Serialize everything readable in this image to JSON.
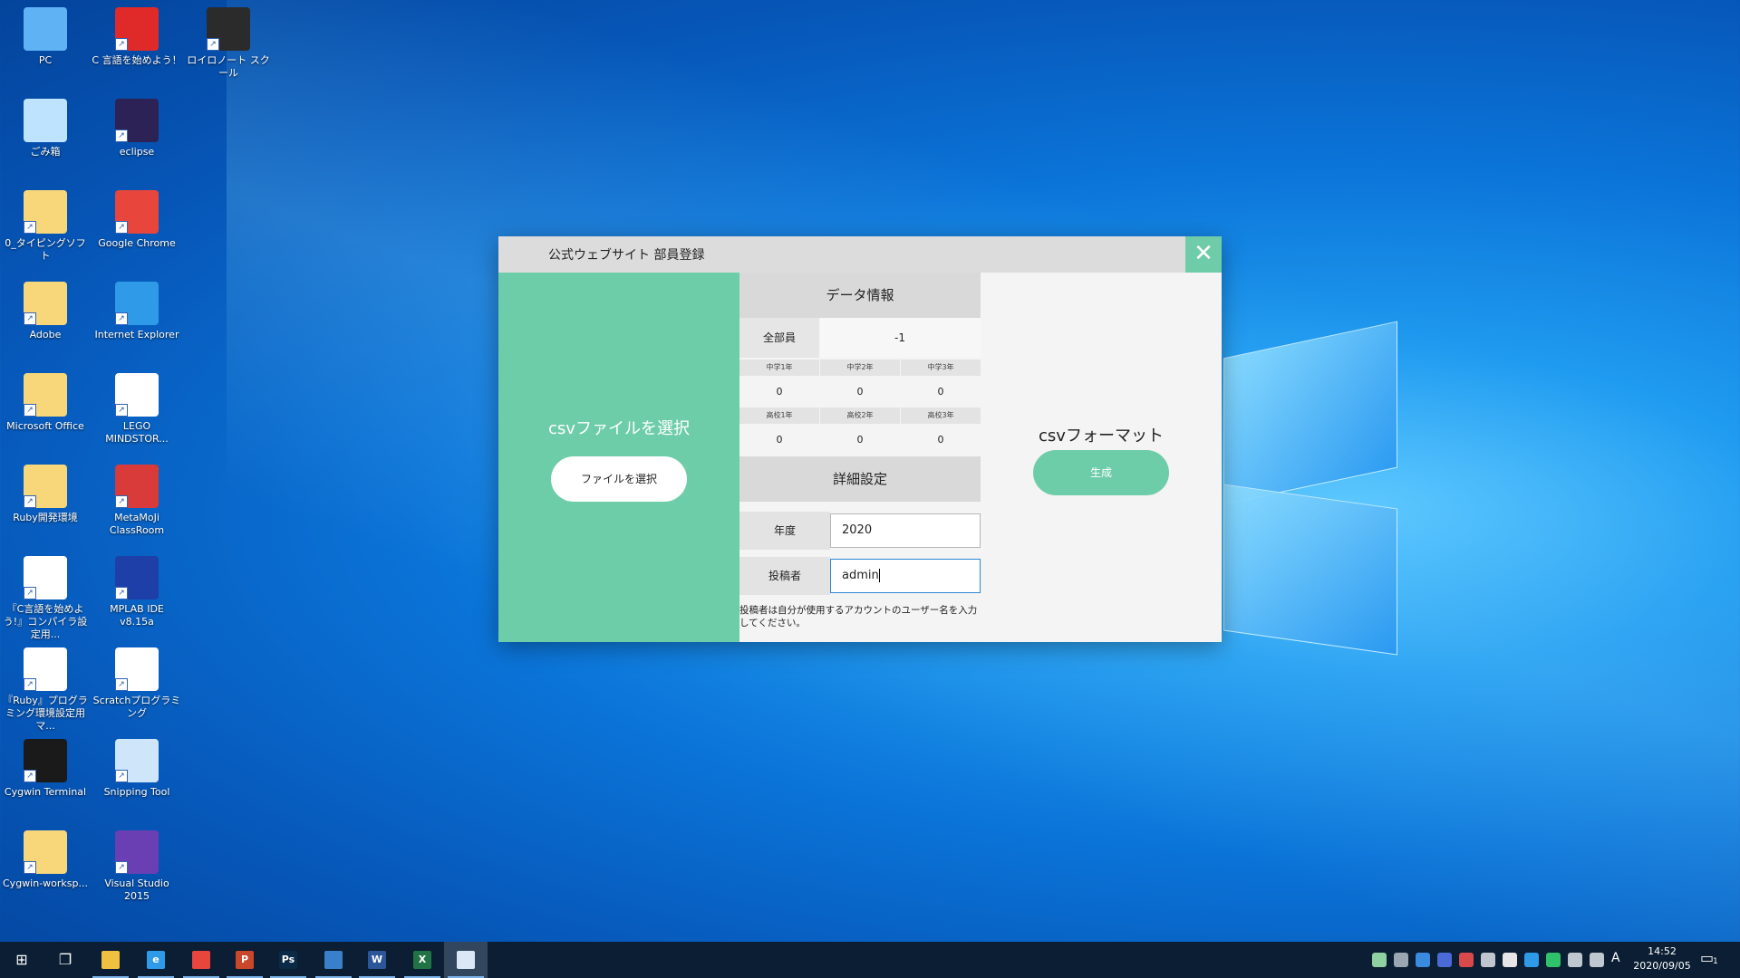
{
  "desktop": {
    "icons": [
      {
        "label": "PC",
        "icon": "pc-icon",
        "color": "#5fb3f5"
      },
      {
        "label": "C 言語を始めよう！",
        "icon": "c-language-icon",
        "color": "#e02a2a"
      },
      {
        "label": "ロイロノート スクール",
        "icon": "loilonote-icon",
        "color": "#2b2b2b"
      },
      {
        "label": "ごみ箱",
        "icon": "recycle-bin-icon",
        "color": "#bde3ff"
      },
      {
        "label": "eclipse",
        "icon": "eclipse-icon",
        "color": "#2c2255"
      },
      {
        "label": "0_タイピングソフト",
        "icon": "folder-icon",
        "color": "#f7d77a"
      },
      {
        "label": "Google Chrome",
        "icon": "chrome-icon",
        "color": "#e8453c"
      },
      {
        "label": "Adobe",
        "icon": "folder-icon",
        "color": "#f7d77a"
      },
      {
        "label": "Internet Explorer",
        "icon": "internet-explorer-icon",
        "color": "#2f9ae8"
      },
      {
        "label": "Microsoft Office",
        "icon": "folder-icon",
        "color": "#f7d77a"
      },
      {
        "label": "LEGO MINDSTOR...",
        "icon": "lego-mindstorms-icon",
        "color": "#ffffff"
      },
      {
        "label": "Ruby開発環境",
        "icon": "folder-icon",
        "color": "#f7d77a"
      },
      {
        "label": "MetaMoJi ClassRoom",
        "icon": "metamoji-icon",
        "color": "#d93a3a"
      },
      {
        "label": "『C言語を始めよう!』コンパイラ設定用...",
        "icon": "pdf-icon",
        "color": "#ffffff"
      },
      {
        "label": "MPLAB IDE v8.15a",
        "icon": "mplab-icon",
        "color": "#1f3fa8"
      },
      {
        "label": "『Ruby』プログラミング環境設定用マ...",
        "icon": "pdf-icon",
        "color": "#ffffff"
      },
      {
        "label": "Scratchプログラミング",
        "icon": "scratch-file-icon",
        "color": "#ffffff"
      },
      {
        "label": "Cygwin Terminal",
        "icon": "cygwin-terminal-icon",
        "color": "#1a1a1a"
      },
      {
        "label": "Snipping Tool",
        "icon": "snipping-tool-icon",
        "color": "#cfe6fa"
      },
      {
        "label": "Cygwin-worksp...",
        "icon": "folder-icon",
        "color": "#f7d77a"
      },
      {
        "label": "Visual Studio 2015",
        "icon": "visual-studio-icon",
        "color": "#6a3fb3"
      }
    ]
  },
  "dialog": {
    "title": "公式ウェブサイト 部員登録",
    "close_glyph": "✕",
    "left": {
      "title": "csvファイルを選択",
      "file_button": "ファイルを選択"
    },
    "data_info": {
      "header": "データ情報",
      "total_label": "全部員",
      "total_value": "-1",
      "junior": [
        {
          "label": "中学1年",
          "value": "0"
        },
        {
          "label": "中学2年",
          "value": "0"
        },
        {
          "label": "中学3年",
          "value": "0"
        }
      ],
      "senior": [
        {
          "label": "高校1年",
          "value": "0"
        },
        {
          "label": "高校2年",
          "value": "0"
        },
        {
          "label": "高校3年",
          "value": "0"
        }
      ]
    },
    "details": {
      "header": "詳細設定",
      "year_label": "年度",
      "year_value": "2020",
      "poster_label": "投稿者",
      "poster_value": "admin",
      "note": "投稿者は自分が使用するアカウントのユーザー名を入力してください。"
    },
    "right": {
      "title": "csvフォーマット",
      "generate_button": "生成"
    }
  },
  "taskbar": {
    "items": [
      {
        "name": "start-icon",
        "glyph": "⊞",
        "color": "transparent"
      },
      {
        "name": "task-view-icon",
        "glyph": "❐",
        "color": "transparent"
      },
      {
        "name": "file-explorer-icon",
        "glyph": "",
        "color": "#f0c040"
      },
      {
        "name": "edge-ie-icon",
        "glyph": "e",
        "color": "#2f9ae8"
      },
      {
        "name": "chrome-icon",
        "glyph": "",
        "color": "#e8453c"
      },
      {
        "name": "powerpoint-icon",
        "glyph": "P",
        "color": "#c9482b"
      },
      {
        "name": "photoshop-icon",
        "glyph": "Ps",
        "color": "#0b2a47"
      },
      {
        "name": "photos-icon",
        "glyph": "",
        "color": "#3a7fc9"
      },
      {
        "name": "word-icon",
        "glyph": "W",
        "color": "#2b579a"
      },
      {
        "name": "excel-icon",
        "glyph": "X",
        "color": "#217346"
      },
      {
        "name": "app-window-icon",
        "glyph": "",
        "color": "#dbe7f5"
      }
    ],
    "ime": "A",
    "time": "14:52",
    "date": "2020/09/05",
    "notification_count": "1"
  }
}
